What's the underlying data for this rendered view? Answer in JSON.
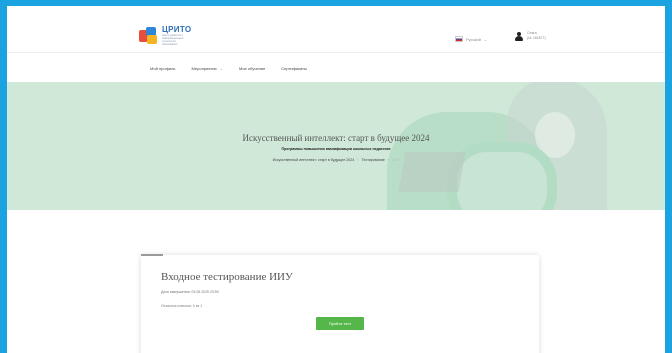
{
  "header": {
    "logo": {
      "title": "ЦРИТО",
      "subtitle": "Центр развития и информационных технологий образования"
    },
    "language": {
      "label": "Русский",
      "chevron": "chevron-down-icon"
    },
    "user": {
      "name": "Ольга",
      "id": "(id: 181877)"
    }
  },
  "nav": {
    "items": [
      {
        "label": "Мой профиль",
        "has_dropdown": false
      },
      {
        "label": "Мероприятия",
        "has_dropdown": true
      },
      {
        "label": "Мое обучение",
        "has_dropdown": false
      },
      {
        "label": "Сертификаты",
        "has_dropdown": false
      }
    ]
  },
  "banner": {
    "title": "Искусственный интеллект: старт в будущее 2024",
    "subtitle": "Программы повышения квалификации школьных педагогов",
    "breadcrumb": [
      "Искусственный интеллект: старт в будущее 2024",
      "Тестирование",
      "ИИУ"
    ]
  },
  "card": {
    "title": "Входное тестирование ИИУ",
    "deadline": "Дата завершения: 03.05.2025 23:59",
    "attempts": "Осталось попыток: 0 из 1",
    "button_label": "Пройти тест"
  },
  "colors": {
    "frame_border": "#1aa3e0",
    "button": "#55b74a",
    "banner_bg": "#cfe8d8"
  }
}
